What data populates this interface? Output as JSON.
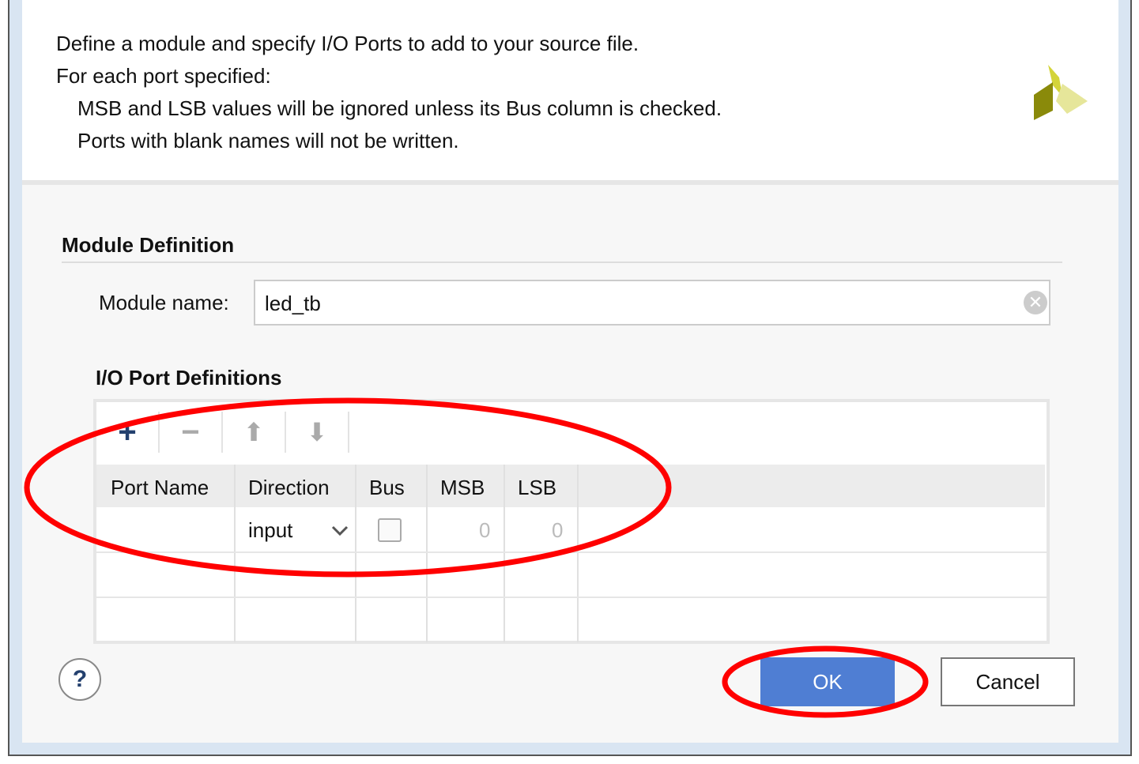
{
  "header": {
    "line1": "Define a module and specify I/O Ports to add to your source file.",
    "line2": "For each port specified:",
    "line3": "MSB and LSB values will be ignored unless its Bus column is checked.",
    "line4": "Ports with blank names will not be written.",
    "logo_icon": "xilinx-logo-icon"
  },
  "module": {
    "section_title": "Module Definition",
    "name_label": "Module name:",
    "name_value": "led_tb"
  },
  "ports": {
    "section_title": "I/O Port Definitions",
    "toolbar": {
      "add": "+",
      "remove": "−",
      "up": "⬆",
      "down": "⬇"
    },
    "columns": [
      "Port Name",
      "Direction",
      "Bus",
      "MSB",
      "LSB"
    ],
    "rows": [
      {
        "port_name": "",
        "direction": "input",
        "bus": false,
        "msb": "0",
        "lsb": "0"
      }
    ]
  },
  "buttons": {
    "help": "?",
    "ok": "OK",
    "cancel": "Cancel"
  },
  "colors": {
    "accent": "#4f7ed3",
    "annotation": "#ff0000"
  }
}
